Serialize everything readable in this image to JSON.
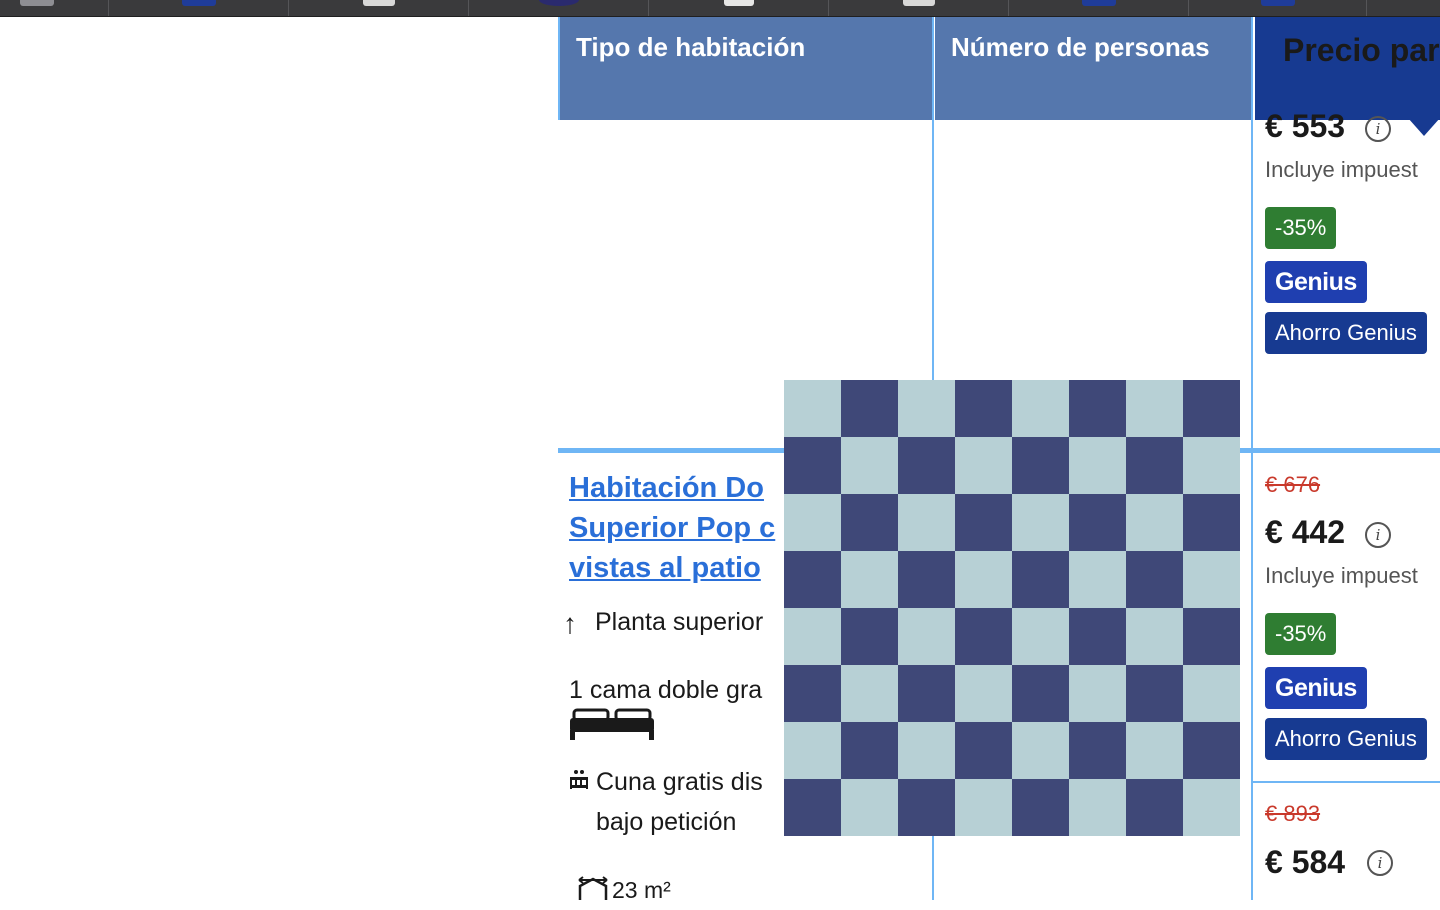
{
  "table": {
    "headers": {
      "room_type": "Tipo de habitación",
      "guests": "Número de personas",
      "price_for": "Precio para"
    }
  },
  "rows": [
    {
      "price": "€ 553",
      "taxes": "Incluye impuest",
      "discount": "-35%",
      "genius_logo": "Genius",
      "genius_saving": "Ahorro Genius"
    },
    {
      "room_name": "Habitación Do Superior Pop c vistas al patio",
      "room_name_lines": [
        "Habitación Do",
        "Superior Pop c",
        "vistas al patio"
      ],
      "floor": "Planta superior",
      "bed": "1 cama doble gra",
      "crib_line1": "Cuna gratis dis",
      "crib_line2": "bajo petición",
      "size": "23 m²",
      "old_price": "€ 676",
      "price": "€ 442",
      "taxes": "Incluye impuest",
      "discount": "-35%",
      "genius_logo": "Genius",
      "genius_saving": "Ahorro Genius"
    },
    {
      "old_price": "€ 893",
      "price": "€ 584"
    }
  ],
  "icons": {
    "info": "i",
    "floor": "↑",
    "bed": "bed-icon",
    "crib": "crib-icon",
    "size": "size-icon"
  },
  "colors": {
    "header": "#5577ad",
    "header_price": "#173a91",
    "link": "#2a6fd8",
    "old_price": "#c9392b",
    "discount": "#2f7d32",
    "genius": "#1f3fb0",
    "grid": "#6fb6f5"
  }
}
